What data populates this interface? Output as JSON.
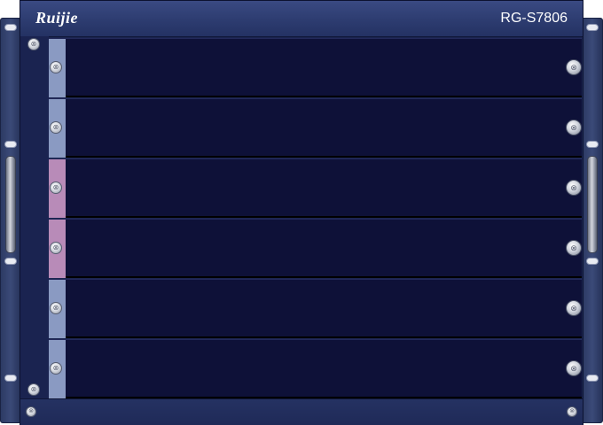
{
  "device": {
    "brand": "Ruijie",
    "model": "RG-S7806"
  },
  "colors": {
    "chassis": "#1b2550",
    "slot_empty": "#0e1138",
    "strip_blue": "#8a9ac2",
    "strip_pink": "#b88bb8"
  },
  "slots": [
    {
      "strip_color": "#8a9ac2"
    },
    {
      "strip_color": "#8a9ac2"
    },
    {
      "strip_color": "#b88bb8"
    },
    {
      "strip_color": "#b88bb8"
    },
    {
      "strip_color": "#8a9ac2"
    },
    {
      "strip_color": "#8a9ac2"
    }
  ],
  "icons": {
    "screw": "⊗"
  }
}
